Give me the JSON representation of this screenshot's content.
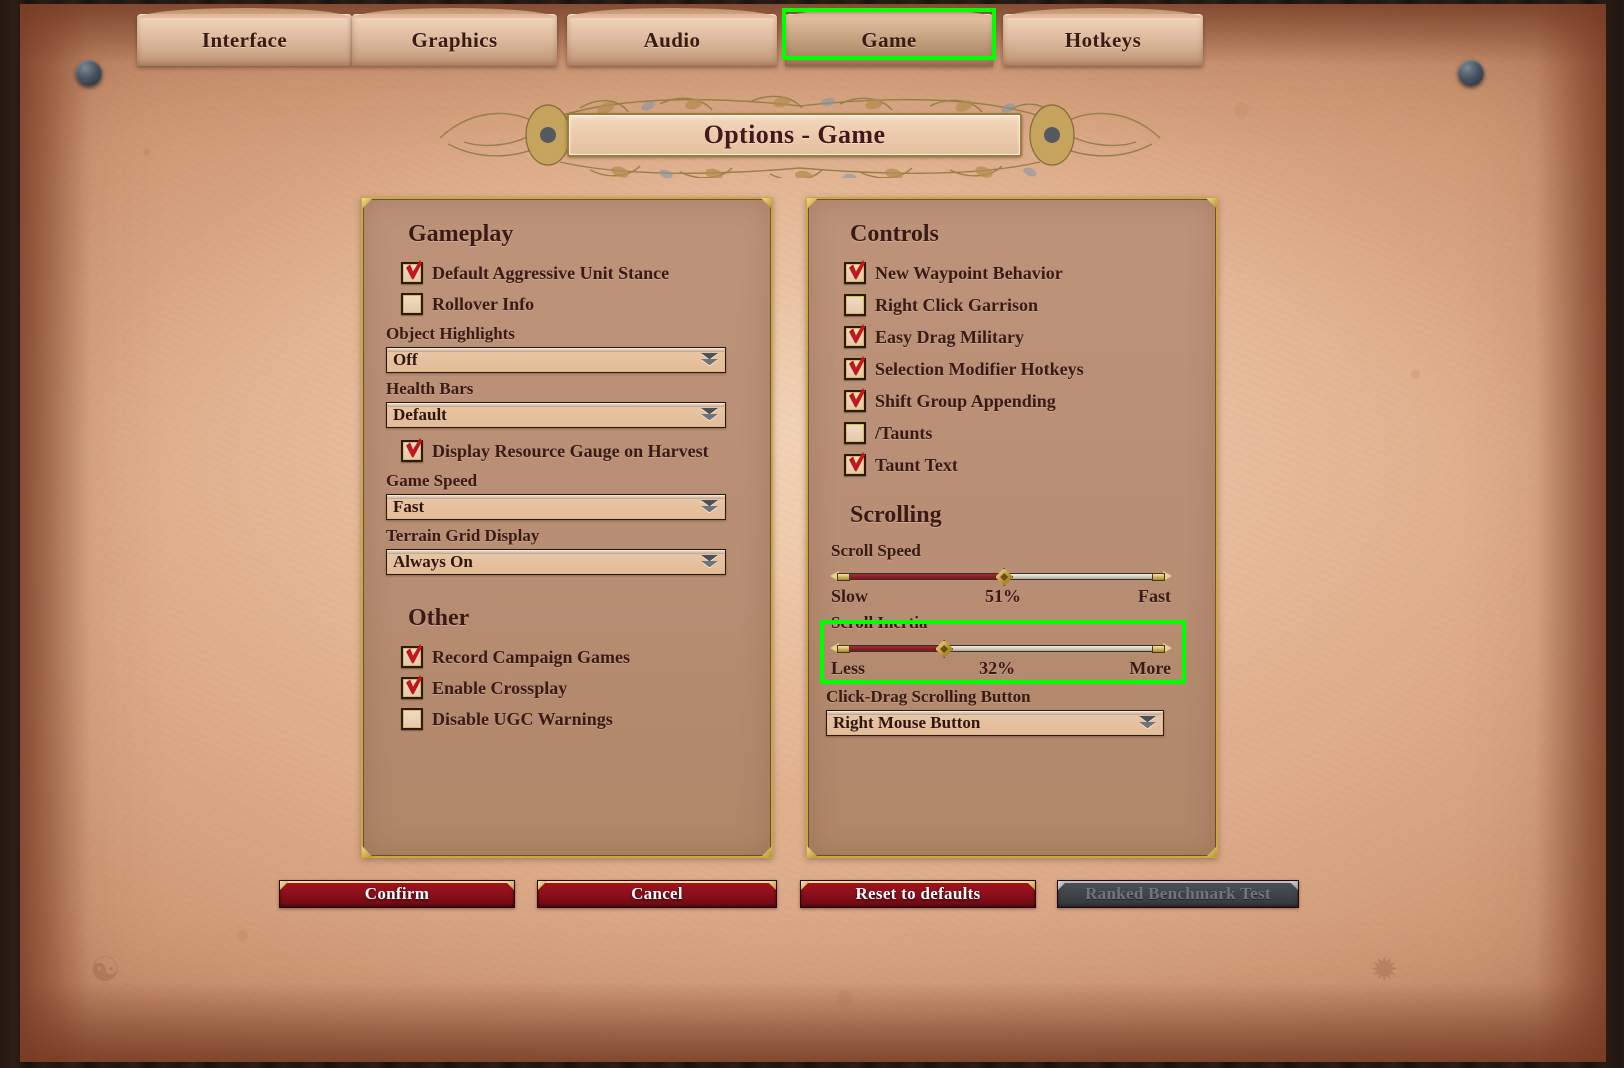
{
  "window": {
    "title": "Options - Game"
  },
  "tabs": [
    {
      "label": "Interface",
      "active": false
    },
    {
      "label": "Graphics",
      "active": false
    },
    {
      "label": "Audio",
      "active": false
    },
    {
      "label": "Game",
      "active": true
    },
    {
      "label": "Hotkeys",
      "active": false
    }
  ],
  "highlight_color": "#00ff00",
  "left_panel": {
    "gameplay": {
      "heading": "Gameplay",
      "checkbox_aggressive": {
        "label": "Default Aggressive Unit Stance",
        "checked": true
      },
      "checkbox_rollover": {
        "label": "Rollover Info",
        "checked": false
      },
      "object_highlights": {
        "label": "Object Highlights",
        "value": "Off"
      },
      "health_bars": {
        "label": "Health Bars",
        "value": "Default"
      },
      "checkbox_resource_gauge": {
        "label": "Display Resource Gauge on Harvest",
        "checked": true
      },
      "game_speed": {
        "label": "Game Speed",
        "value": "Fast"
      },
      "terrain_grid": {
        "label": "Terrain Grid Display",
        "value": "Always On"
      }
    },
    "other": {
      "heading": "Other",
      "checkbox_record": {
        "label": "Record Campaign Games",
        "checked": true
      },
      "checkbox_crossplay": {
        "label": "Enable Crossplay",
        "checked": true
      },
      "checkbox_ugc": {
        "label": "Disable UGC Warnings",
        "checked": false
      }
    }
  },
  "right_panel": {
    "controls": {
      "heading": "Controls",
      "checkbox_waypoint": {
        "label": "New Waypoint Behavior",
        "checked": true
      },
      "checkbox_garrison": {
        "label": "Right Click Garrison",
        "checked": false
      },
      "checkbox_easydrag": {
        "label": "Easy Drag Military",
        "checked": true
      },
      "checkbox_selmod": {
        "label": "Selection Modifier Hotkeys",
        "checked": true
      },
      "checkbox_shiftgroup": {
        "label": "Shift Group Appending",
        "checked": true
      },
      "checkbox_taunts": {
        "label": "/Taunts",
        "checked": false
      },
      "checkbox_taunttext": {
        "label": "Taunt Text",
        "checked": true
      }
    },
    "scrolling": {
      "heading": "Scrolling",
      "scroll_speed": {
        "label": "Scroll Speed",
        "value_text": "51%",
        "percent": 51,
        "min_label": "Slow",
        "max_label": "Fast"
      },
      "scroll_inertia": {
        "label": "Scroll Inertia",
        "value_text": "32%",
        "percent": 32,
        "min_label": "Less",
        "max_label": "More",
        "highlighted": true
      },
      "click_drag_button": {
        "label": "Click-Drag Scrolling Button",
        "value": "Right Mouse Button"
      }
    }
  },
  "footer": {
    "confirm": "Confirm",
    "cancel": "Cancel",
    "reset": "Reset to defaults",
    "ranked": "Ranked Benchmark Test"
  }
}
